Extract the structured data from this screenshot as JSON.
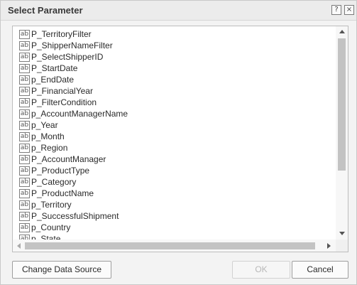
{
  "window": {
    "title": "Select Parameter",
    "help_glyph": "?",
    "close_glyph": "×"
  },
  "list": {
    "item_icon_text": "ab",
    "items": [
      "P_TerritoryFilter",
      "P_ShipperNameFilter",
      "P_SelectShipperID",
      "P_StartDate",
      "p_EndDate",
      "P_FinancialYear",
      "P_FilterCondition",
      "p_AccountManagerName",
      "p_Year",
      "p_Month",
      "p_Region",
      "P_AccountManager",
      "P_ProductType",
      "P_Category",
      "P_ProductName",
      "p_Territory",
      "P_SuccessfulShipment",
      "p_Country",
      "p_State"
    ]
  },
  "buttons": {
    "change_data_source": "Change Data Source",
    "ok": "OK",
    "cancel": "Cancel"
  }
}
